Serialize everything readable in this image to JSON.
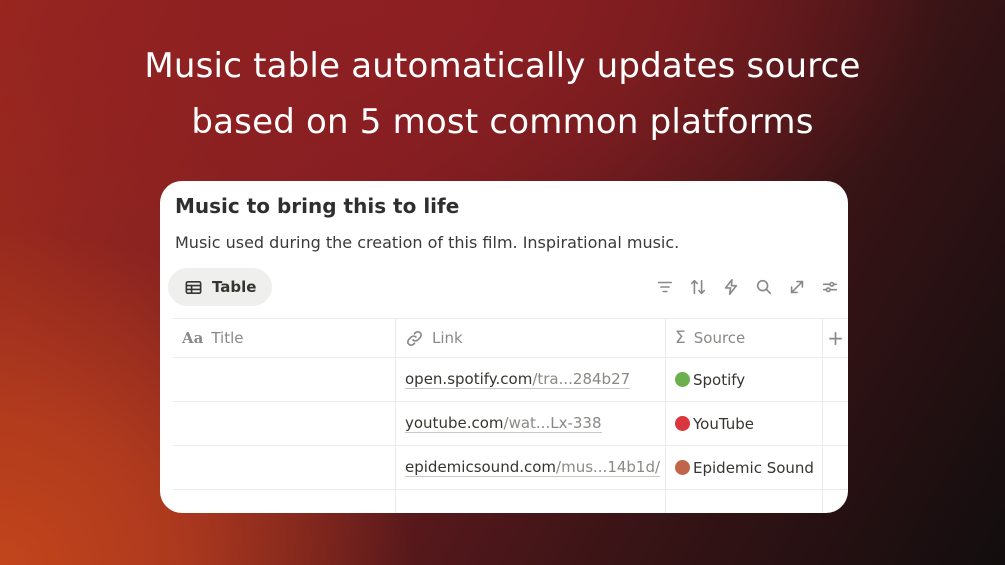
{
  "headline": {
    "line1": "Music table automatically updates source",
    "line2": "based on 5 most common platforms"
  },
  "database": {
    "title": "Music to bring this to life",
    "description": "Music used during the creation of this film. Inspirational music.",
    "view_tab_label": "Table",
    "view_tab_icon": "table-icon",
    "toolbar_icons": [
      "filter-icon",
      "sort-icon",
      "lightning-icon",
      "search-icon",
      "expand-icon",
      "settings-icon"
    ],
    "columns": [
      {
        "label": "Title",
        "icon": "title-aa-icon",
        "icon_text": "Aa"
      },
      {
        "label": "Link",
        "icon": "link-icon"
      },
      {
        "label": "Source",
        "icon": "sigma-icon",
        "icon_text": "Σ"
      },
      {
        "label": "+",
        "icon": "plus-icon"
      }
    ],
    "rows": [
      {
        "title": "",
        "link_domain": "open.spotify.com",
        "link_path": "/tra...284b27",
        "source": "Spotify",
        "source_color": "#6ab04c"
      },
      {
        "title": "",
        "link_domain": "youtube.com",
        "link_path": "/wat...Lx-338",
        "source": "YouTube",
        "source_color": "#d9363e"
      },
      {
        "title": "",
        "link_domain": "epidemicsound.com",
        "link_path": "/mus...14b1d/",
        "source": "Epidemic Sound",
        "source_color": "#c0654a"
      }
    ]
  }
}
